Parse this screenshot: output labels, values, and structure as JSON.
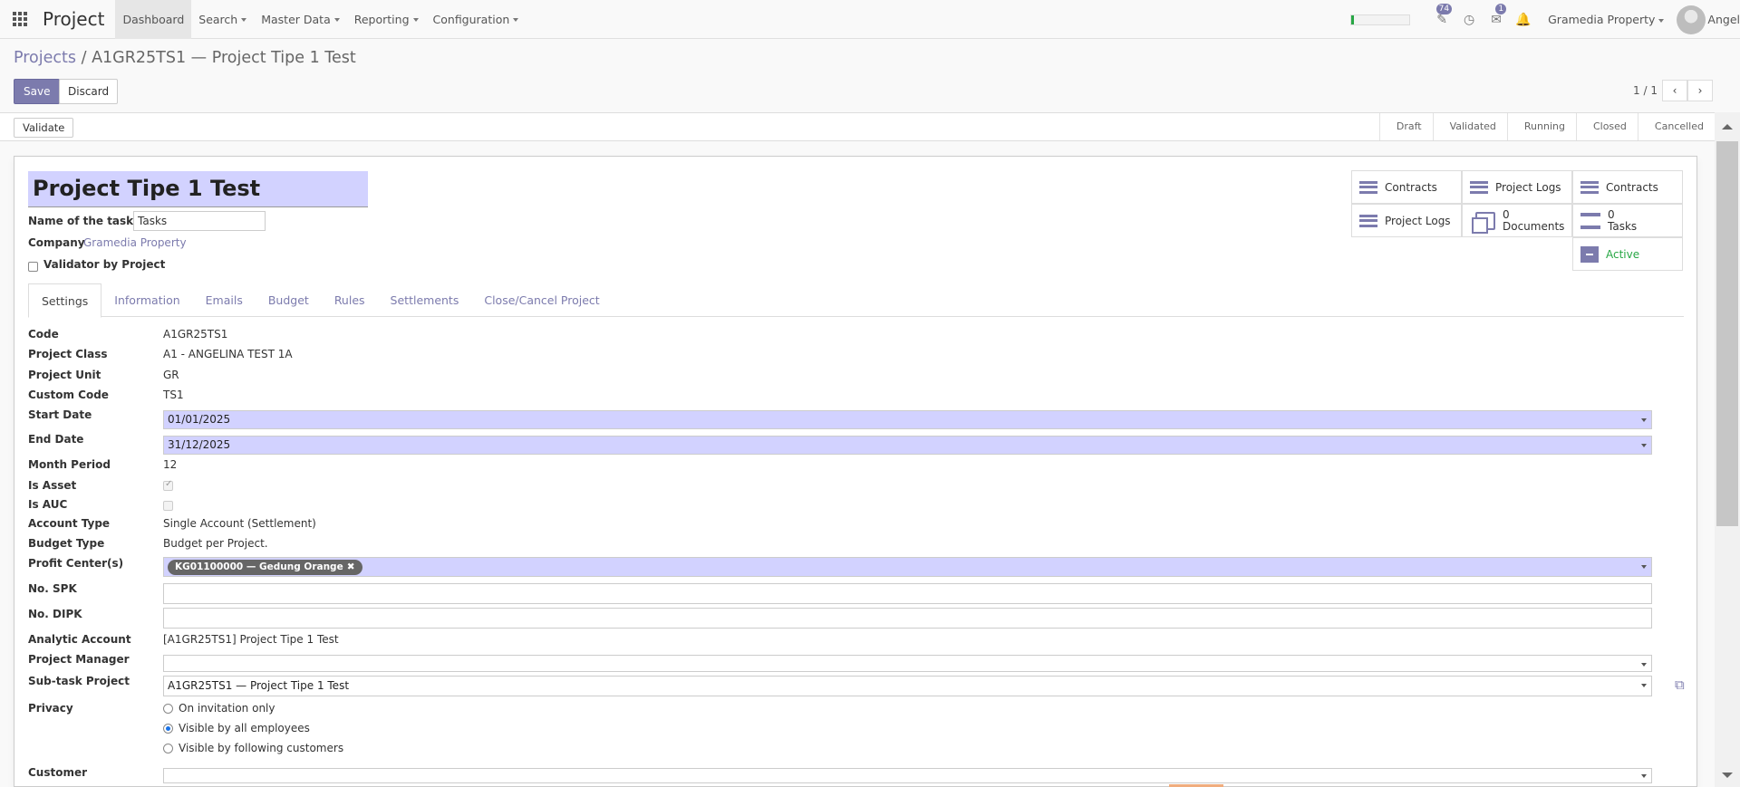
{
  "topbar": {
    "app_name": "Project",
    "menu": [
      "Dashboard",
      "Search",
      "Master Data",
      "Reporting",
      "Configuration"
    ],
    "activity_badge": "74",
    "chat_badge": "1",
    "company": "Gramedia Property",
    "user": "Angel"
  },
  "breadcrumb": {
    "parent": "Projects",
    "sep": "/",
    "current": "A1GR25TS1 — Project Tipe 1 Test"
  },
  "actions": {
    "save": "Save",
    "discard": "Discard"
  },
  "pager": {
    "text": "1 / 1",
    "prev": "‹",
    "next": "›"
  },
  "statusbar": {
    "validate": "Validate",
    "stages": [
      "Draft",
      "Validated",
      "Running",
      "Closed",
      "Cancelled"
    ]
  },
  "form": {
    "title": "Project Tipe 1 Test",
    "tasks_label": "Name of the tasks :",
    "tasks_value": "Tasks",
    "company_label": "Company",
    "company_value": "Gramedia Property",
    "validator_label": "Validator by Project"
  },
  "smart_buttons": {
    "contracts_1": "Contracts",
    "project_logs_1": "Project Logs",
    "contracts_2": "Contracts",
    "project_logs_2": "Project Logs",
    "documents_count": "0",
    "documents_label": "Documents",
    "tasks_count": "0",
    "tasks_label": "Tasks",
    "active_label": "Active"
  },
  "tabs": [
    "Settings",
    "Information",
    "Emails",
    "Budget",
    "Rules",
    "Settlements",
    "Close/Cancel Project"
  ],
  "fields": {
    "code": {
      "label": "Code",
      "value": "A1GR25TS1"
    },
    "project_class": {
      "label": "Project Class",
      "value": "A1 - ANGELINA TEST 1A"
    },
    "project_unit": {
      "label": "Project Unit",
      "value": "GR"
    },
    "custom_code": {
      "label": "Custom Code",
      "value": "TS1"
    },
    "start_date": {
      "label": "Start Date",
      "value": "01/01/2025"
    },
    "end_date": {
      "label": "End Date",
      "value": "31/12/2025"
    },
    "month_period": {
      "label": "Month Period",
      "value": "12"
    },
    "is_asset": {
      "label": "Is Asset"
    },
    "is_auc": {
      "label": "Is AUC"
    },
    "account_type": {
      "label": "Account Type",
      "value": "Single Account (Settlement)"
    },
    "budget_type": {
      "label": "Budget Type",
      "value": "Budget per Project."
    },
    "profit_center": {
      "label": "Profit Center(s)",
      "tag": "KG01100000 — Gedung Orange",
      "tag_x": "✖"
    },
    "no_spk": {
      "label": "No. SPK"
    },
    "no_dipk": {
      "label": "No. DIPK"
    },
    "analytic_account": {
      "label": "Analytic Account",
      "value": "[A1GR25TS1] Project Tipe 1 Test"
    },
    "project_manager": {
      "label": "Project Manager"
    },
    "subtask_project": {
      "label": "Sub-task Project",
      "value": "A1GR25TS1 — Project Tipe 1 Test"
    },
    "privacy": {
      "label": "Privacy",
      "options": [
        "On invitation only",
        "Visible by all employees",
        "Visible by following customers"
      ]
    },
    "customer": {
      "label": "Customer"
    }
  },
  "colors": {
    "accent": "#7c7bad",
    "required_bg": "#d2d2ff",
    "active_green": "#28a745"
  },
  "progress_fraction": 0.05
}
